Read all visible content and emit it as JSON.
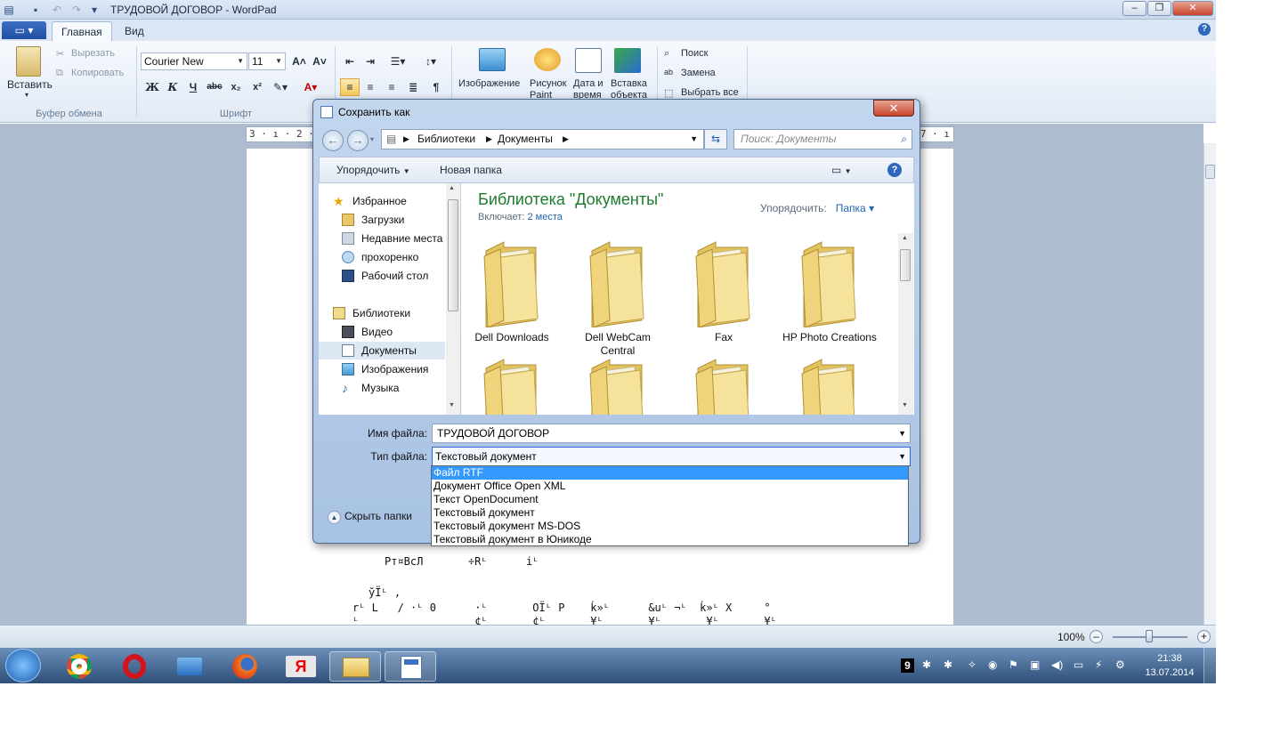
{
  "window": {
    "title": "ТРУДОВОЙ ДОГОВОР - WordPad"
  },
  "ribbon": {
    "tabs": [
      "Главная",
      "Вид"
    ],
    "clipboard": {
      "paste": "Вставить",
      "cut": "Вырезать",
      "copy": "Копировать",
      "group": "Буфер обмена"
    },
    "font": {
      "name": "Courier New",
      "size": "11",
      "group": "Шрифт"
    },
    "insert": {
      "image": "Изображение",
      "paint": "Рисунок Paint",
      "datetime": "Дата и время",
      "object": "Вставка объекта",
      "group": "Вставка"
    },
    "editing": {
      "find": "Поиск",
      "replace": "Замена",
      "select_all": "Выбрать все",
      "group": "Правка"
    }
  },
  "ruler": {
    "left": "3 · ı · 2 · ı",
    "right": "17 · ı"
  },
  "document": {
    "lines": [
      "Рт¤ВсЛ       ÷Rᴸ      iᴸ",
      "ўÏᴸ ,",
      "rᴸ L   / ·ᴸ 0      ·ᴸ       OÏᴸ P    ḱ»ᴸ      &uᴸ ¬ᴸ  ḱ»ᴸ X     °",
      "ᴸ                  ¢ᴸ       ¢ᴸ       ¥ᴸ       ¥ᴸ       ¥ᴸ       ¥ᴸ"
    ]
  },
  "status": {
    "zoom": "100%"
  },
  "taskbar": {
    "time": "21:38",
    "date": "13.07.2014",
    "tray_badge": "9"
  },
  "dialog": {
    "title": "Сохранить как",
    "address": [
      "Библиотеки",
      "Документы"
    ],
    "search_placeholder": "Поиск: Документы",
    "organize": "Упорядочить",
    "new_folder": "Новая папка",
    "nav": {
      "favorites": "Избранное",
      "fav_items": [
        "Загрузки",
        "Недавние места",
        "прохоренко",
        "Рабочий стол"
      ],
      "libraries": "Библиотеки",
      "lib_items": [
        "Видео",
        "Документы",
        "Изображения",
        "Музыка"
      ]
    },
    "library": {
      "title": "Библиотека \"Документы\"",
      "includes": "Включает:",
      "locations": "2 места",
      "arrange_label": "Упорядочить:",
      "arrange_value": "Папка"
    },
    "folders": [
      "Dell Downloads",
      "Dell WebCam Central",
      "Fax",
      "HP Photo Creations"
    ],
    "filename_label": "Имя файла:",
    "filename_value": "ТРУДОВОЙ ДОГОВОР",
    "filetype_label": "Тип файла:",
    "filetype_value": "Текстовый документ",
    "hide_folders": "Скрыть папки",
    "type_options": [
      "Файл RTF",
      "Документ Office Open XML",
      "Текст OpenDocument",
      "Текстовый документ",
      "Текстовый документ MS-DOS",
      "Текстовый документ в Юникоде"
    ],
    "highlighted_option": "Файл RTF"
  },
  "colors": {
    "accent": "#3399ff",
    "library_title": "#1e7b2e",
    "link": "#1b64b4"
  }
}
